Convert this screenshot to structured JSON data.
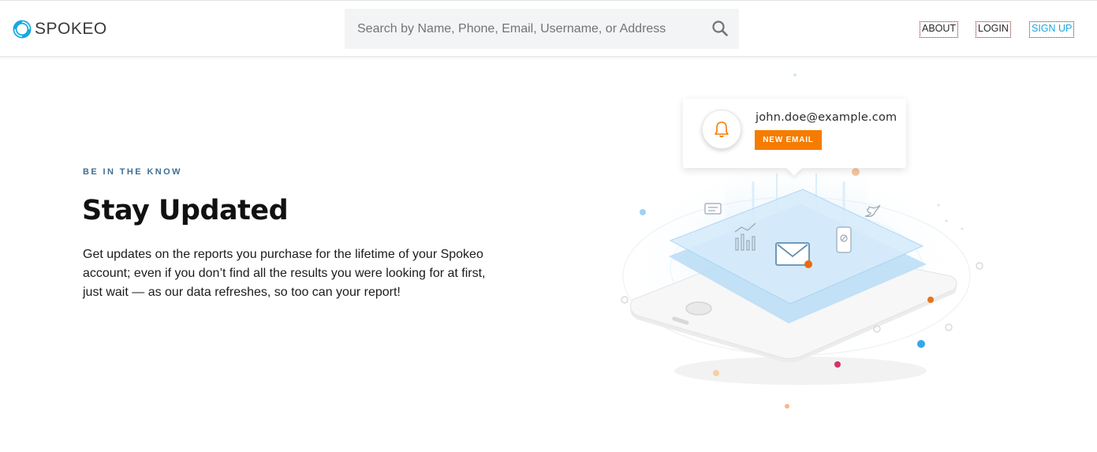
{
  "header": {
    "logo_text": "SPOKEO",
    "search_placeholder": "Search by Name, Phone, Email, Username, or Address",
    "search_value": "",
    "nav": {
      "about": "ABOUT",
      "login": "LOGIN",
      "signup": "SIGN UP"
    }
  },
  "hero": {
    "eyebrow": "BE IN THE KNOW",
    "title": "Stay Updated",
    "description": "Get updates on the reports you purchase for the lifetime of your Spokeo account; even if you don’t find all the results you were looking for at first, just wait — as our data refreshes, so too can your report!"
  },
  "notification": {
    "email": "john.doe@example.com",
    "badge": "NEW EMAIL",
    "icon": "bell-icon"
  },
  "colors": {
    "brand_blue": "#1aa7e0",
    "eyebrow_blue": "#3e6f95",
    "accent_orange": "#f57c00"
  }
}
